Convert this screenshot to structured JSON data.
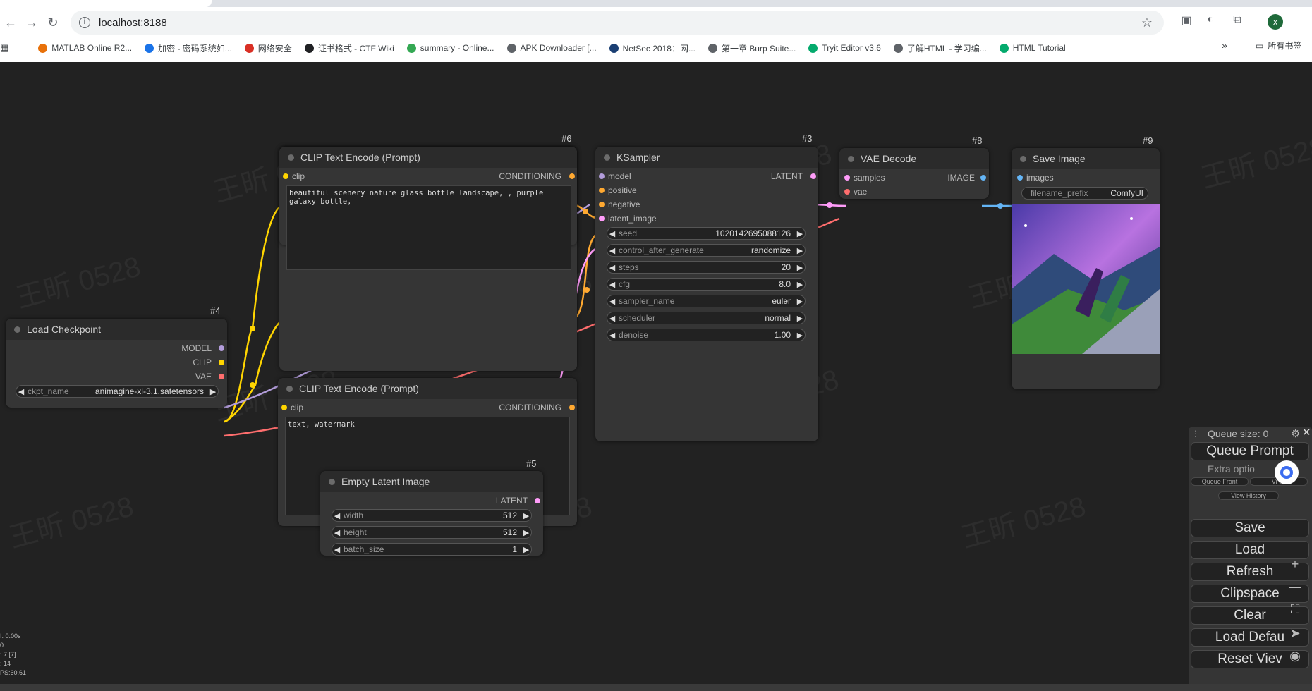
{
  "browser": {
    "url": "localhost:8188",
    "avatar_letter": "x",
    "bookmarks": [
      {
        "label": "MATLAB Online R2...",
        "color": "#e8710a"
      },
      {
        "label": "加密 - 密码系统如...",
        "color": "#1a73e8"
      },
      {
        "label": "网络安全",
        "color": "#d93025"
      },
      {
        "label": "证书格式 - CTF Wiki",
        "color": "#202124"
      },
      {
        "label": "summary - Online...",
        "color": "#34a853"
      },
      {
        "label": "APK Downloader [...",
        "color": "#5f6368"
      },
      {
        "label": "NetSec 2018：网...",
        "color": "#1a3f73"
      },
      {
        "label": "第一章 Burp Suite...",
        "color": "#5f6368"
      },
      {
        "label": "Tryit Editor v3.6",
        "color": "#04aa6d"
      },
      {
        "label": "了解HTML - 学习编...",
        "color": "#5f6368"
      },
      {
        "label": "HTML Tutorial",
        "color": "#04aa6d"
      }
    ],
    "more": "»",
    "all_bookmarks": "所有书签"
  },
  "watermark": "王昕 0528",
  "nodes": {
    "clip1": {
      "id": "#6",
      "title": "CLIP Text Encode (Prompt)",
      "input": "clip",
      "output": "CONDITIONING",
      "text": "beautiful scenery nature glass bottle landscape, , purple galaxy bottle,"
    },
    "clip2": {
      "title": "CLIP Text Encode (Prompt)",
      "input": "clip",
      "output": "CONDITIONING",
      "text": "text, watermark"
    },
    "ksampler": {
      "id": "#3",
      "title": "KSampler",
      "output": "LATENT",
      "inputs": [
        "model",
        "positive",
        "negative",
        "latent_image"
      ],
      "widgets": [
        {
          "label": "seed",
          "value": "1020142695088126"
        },
        {
          "label": "control_after_generate",
          "value": "randomize"
        },
        {
          "label": "steps",
          "value": "20"
        },
        {
          "label": "cfg",
          "value": "8.0"
        },
        {
          "label": "sampler_name",
          "value": "euler"
        },
        {
          "label": "scheduler",
          "value": "normal"
        },
        {
          "label": "denoise",
          "value": "1.00"
        }
      ]
    },
    "vae": {
      "id": "#8",
      "title": "VAE Decode",
      "inputs": [
        "samples",
        "vae"
      ],
      "output": "IMAGE"
    },
    "save": {
      "id": "#9",
      "title": "Save Image",
      "input": "images",
      "widget_label": "filename_prefix",
      "widget_value": "ComfyUI"
    },
    "checkpoint": {
      "id": "#4",
      "title": "Load Checkpoint",
      "outputs": [
        "MODEL",
        "CLIP",
        "VAE"
      ],
      "widget_label": "ckpt_name",
      "widget_value": "animagine-xl-3.1.safetensors"
    },
    "latent": {
      "id": "#5",
      "title": "Empty Latent Image",
      "output": "LATENT",
      "widgets": [
        {
          "label": "width",
          "value": "512"
        },
        {
          "label": "height",
          "value": "512"
        },
        {
          "label": "batch_size",
          "value": "1"
        }
      ]
    }
  },
  "panel": {
    "queue_size": "Queue size: 0",
    "queue_prompt": "Queue Prompt",
    "extra_options": "Extra optio",
    "queue_front": "Queue Front",
    "view_queue": "Vi      ue",
    "view_history": "View History",
    "buttons": [
      "Save",
      "Load",
      "Refresh",
      "Clipspace",
      "Clear",
      "Load Defau",
      "Reset Viev"
    ]
  },
  "stats": [
    "I: 0.00s",
    "0",
    ": 7 [7]",
    ": 14",
    "PS:60.61"
  ],
  "colors": {
    "clip": "#ffd500",
    "model": "#b39ddb",
    "vae": "#ff6e6e",
    "latent": "#ff9cf9",
    "conditioning": "#ffa931",
    "image": "#64b5f6",
    "canvas": "#222222",
    "node": "#353535"
  }
}
